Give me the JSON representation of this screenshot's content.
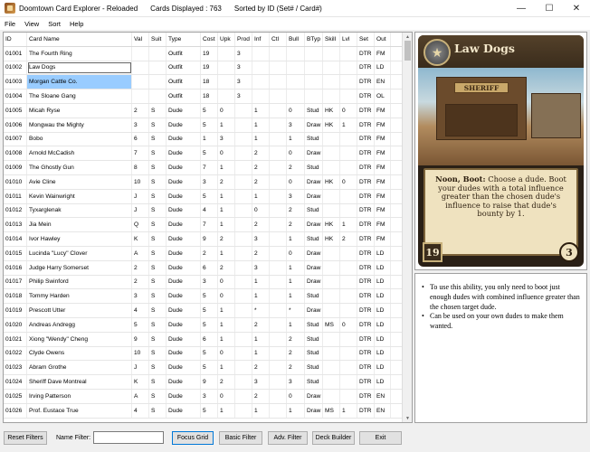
{
  "window": {
    "title": "Doomtown Card Explorer - Reloaded",
    "cards_displayed": "Cards Displayed : 763",
    "sorted_by": "Sorted by  ID (Set# / Card#)"
  },
  "menu": [
    "File",
    "View",
    "Sort",
    "Help"
  ],
  "grid": {
    "columns": [
      "ID",
      "Card Name",
      "Val",
      "Suit",
      "Type",
      "Cost",
      "Upk",
      "Prod",
      "Inf",
      "Ctl",
      "Bull",
      "BTyp",
      "Skill",
      "Lvl",
      "Set",
      "Out"
    ],
    "rows": [
      [
        "01001",
        "The Fourth Ring",
        "",
        "",
        "Outfit",
        "19",
        "",
        "3",
        "",
        "",
        "",
        "",
        "",
        "",
        "DTR",
        "FM"
      ],
      [
        "01002",
        "Law Dogs",
        "",
        "",
        "Outfit",
        "19",
        "",
        "3",
        "",
        "",
        "",
        "",
        "",
        "",
        "DTR",
        "LD"
      ],
      [
        "01003",
        "Morgan Cattle Co.",
        "",
        "",
        "Outfit",
        "18",
        "",
        "3",
        "",
        "",
        "",
        "",
        "",
        "",
        "DTR",
        "EN"
      ],
      [
        "01004",
        "The Sloane Gang",
        "",
        "",
        "Outfit",
        "18",
        "",
        "3",
        "",
        "",
        "",
        "",
        "",
        "",
        "DTR",
        "OL"
      ],
      [
        "01005",
        "Micah Ryse",
        "2",
        "S",
        "Dude",
        "5",
        "0",
        "",
        "1",
        "",
        "0",
        "Stud",
        "HK",
        "0",
        "DTR",
        "FM"
      ],
      [
        "01006",
        "Mongwau the Mighty",
        "3",
        "S",
        "Dude",
        "5",
        "1",
        "",
        "1",
        "",
        "3",
        "Draw",
        "HK",
        "1",
        "DTR",
        "FM"
      ],
      [
        "01007",
        "Bobo",
        "6",
        "S",
        "Dude",
        "1",
        "3",
        "",
        "1",
        "",
        "1",
        "Stud",
        "",
        "",
        "DTR",
        "FM"
      ],
      [
        "01008",
        "Arnold McCadish",
        "7",
        "S",
        "Dude",
        "5",
        "0",
        "",
        "2",
        "",
        "0",
        "Draw",
        "",
        "",
        "DTR",
        "FM"
      ],
      [
        "01009",
        "The Ghostly Gun",
        "8",
        "S",
        "Dude",
        "7",
        "1",
        "",
        "2",
        "",
        "2",
        "Stud",
        "",
        "",
        "DTR",
        "FM"
      ],
      [
        "01010",
        "Avie Cline",
        "10",
        "S",
        "Dude",
        "3",
        "2",
        "",
        "2",
        "",
        "0",
        "Draw",
        "HK",
        "0",
        "DTR",
        "FM"
      ],
      [
        "01011",
        "Kevin Wainwright",
        "J",
        "S",
        "Dude",
        "5",
        "1",
        "",
        "1",
        "",
        "3",
        "Draw",
        "",
        "",
        "DTR",
        "FM"
      ],
      [
        "01012",
        "Tyxarglenak",
        "J",
        "S",
        "Dude",
        "4",
        "1",
        "",
        "0",
        "",
        "2",
        "Stud",
        "",
        "",
        "DTR",
        "FM"
      ],
      [
        "01013",
        "Jia Mein",
        "Q",
        "S",
        "Dude",
        "7",
        "1",
        "",
        "2",
        "",
        "2",
        "Draw",
        "HK",
        "1",
        "DTR",
        "FM"
      ],
      [
        "01014",
        "Ivor Hawley",
        "K",
        "S",
        "Dude",
        "9",
        "2",
        "",
        "3",
        "",
        "1",
        "Stud",
        "HK",
        "2",
        "DTR",
        "FM"
      ],
      [
        "01015",
        "Lucinda \"Lucy\" Clover",
        "A",
        "S",
        "Dude",
        "2",
        "1",
        "",
        "2",
        "",
        "0",
        "Draw",
        "",
        "",
        "DTR",
        "LD"
      ],
      [
        "01016",
        "Judge Harry Somerset",
        "2",
        "S",
        "Dude",
        "6",
        "2",
        "",
        "3",
        "",
        "1",
        "Draw",
        "",
        "",
        "DTR",
        "LD"
      ],
      [
        "01017",
        "Philip Swinford",
        "2",
        "S",
        "Dude",
        "3",
        "0",
        "",
        "1",
        "",
        "1",
        "Draw",
        "",
        "",
        "DTR",
        "LD"
      ],
      [
        "01018",
        "Tommy Harden",
        "3",
        "S",
        "Dude",
        "5",
        "0",
        "",
        "1",
        "",
        "1",
        "Stud",
        "",
        "",
        "DTR",
        "LD"
      ],
      [
        "01019",
        "Prescott Utter",
        "4",
        "S",
        "Dude",
        "5",
        "1",
        "",
        "*",
        "",
        "*",
        "Draw",
        "",
        "",
        "DTR",
        "LD"
      ],
      [
        "01020",
        "Andreas Andregg",
        "5",
        "S",
        "Dude",
        "5",
        "1",
        "",
        "2",
        "",
        "1",
        "Stud",
        "MS",
        "0",
        "DTR",
        "LD"
      ],
      [
        "01021",
        "Xiong \"Wendy\" Cheng",
        "9",
        "S",
        "Dude",
        "6",
        "1",
        "",
        "1",
        "",
        "2",
        "Stud",
        "",
        "",
        "DTR",
        "LD"
      ],
      [
        "01022",
        "Clyde Owens",
        "10",
        "S",
        "Dude",
        "5",
        "0",
        "",
        "1",
        "",
        "2",
        "Stud",
        "",
        "",
        "DTR",
        "LD"
      ],
      [
        "01023",
        "Abram Grothe",
        "J",
        "S",
        "Dude",
        "5",
        "1",
        "",
        "2",
        "",
        "2",
        "Stud",
        "",
        "",
        "DTR",
        "LD"
      ],
      [
        "01024",
        "Sheriff Dave Montreal",
        "K",
        "S",
        "Dude",
        "9",
        "2",
        "",
        "3",
        "",
        "3",
        "Stud",
        "",
        "",
        "DTR",
        "LD"
      ],
      [
        "01025",
        "Irving Patterson",
        "A",
        "S",
        "Dude",
        "3",
        "0",
        "",
        "2",
        "",
        "0",
        "Draw",
        "",
        "",
        "DTR",
        "EN"
      ],
      [
        "01026",
        "Prof. Eustace True",
        "4",
        "S",
        "Dude",
        "5",
        "1",
        "",
        "1",
        "",
        "1",
        "Draw",
        "MS",
        "1",
        "DTR",
        "EN"
      ]
    ]
  },
  "card": {
    "title": "Law Dogs",
    "sign_text": "SHERIFF",
    "ability_keyword": "Noon, Boot:",
    "ability_text": " Choose a dude. Boot your dudes with a total influence greater than the chosen dude's influence to raise that dude's bounty by 1.",
    "wealth": "19",
    "production": "3"
  },
  "rulings": [
    "To use this ability, you only need to boot just enough dudes with combined influence greater than the chosen target dude.",
    "Can be used on your own dudes to make them wanted."
  ],
  "toolbar": {
    "reset_filters": "Reset Filters",
    "name_filter_label": "Name Filter:",
    "name_filter_value": "",
    "focus_grid": "Focus Grid",
    "basic_filter": "Basic Filter",
    "adv_filter": "Adv. Filter",
    "deck_builder": "Deck Builder",
    "exit": "Exit"
  },
  "colors": {
    "selection": "#99ccff",
    "card_frame": "#3a2c1c",
    "card_text_bg": "#efe2bf"
  },
  "icons": {
    "app": "doomtown-app-icon",
    "minimize": "minimize-icon",
    "maximize": "maximize-icon",
    "close": "close-icon",
    "badge": "sheriff-star-icon"
  }
}
